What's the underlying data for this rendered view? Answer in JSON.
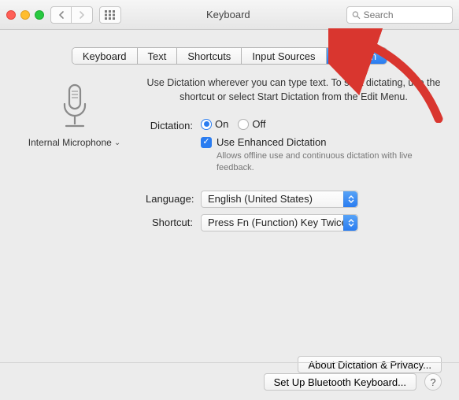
{
  "window": {
    "title": "Keyboard",
    "search_placeholder": "Search"
  },
  "tabs": [
    {
      "label": "Keyboard"
    },
    {
      "label": "Text"
    },
    {
      "label": "Shortcuts"
    },
    {
      "label": "Input Sources"
    },
    {
      "label": "Dictation",
      "active": true
    }
  ],
  "mic": {
    "label": "Internal Microphone"
  },
  "intro": "Use Dictation wherever you can type text. To start dictating, use the shortcut or select Start Dictation from the Edit Menu.",
  "dictation": {
    "label": "Dictation:",
    "on": "On",
    "off": "Off",
    "enhanced": "Use Enhanced Dictation",
    "hint": "Allows offline use and continuous dictation with live feedback."
  },
  "language": {
    "label": "Language:",
    "value": "English (United States)"
  },
  "shortcut": {
    "label": "Shortcut:",
    "value": "Press Fn (Function) Key Twice"
  },
  "buttons": {
    "about": "About Dictation & Privacy...",
    "bluetooth": "Set Up Bluetooth Keyboard...",
    "help": "?"
  }
}
